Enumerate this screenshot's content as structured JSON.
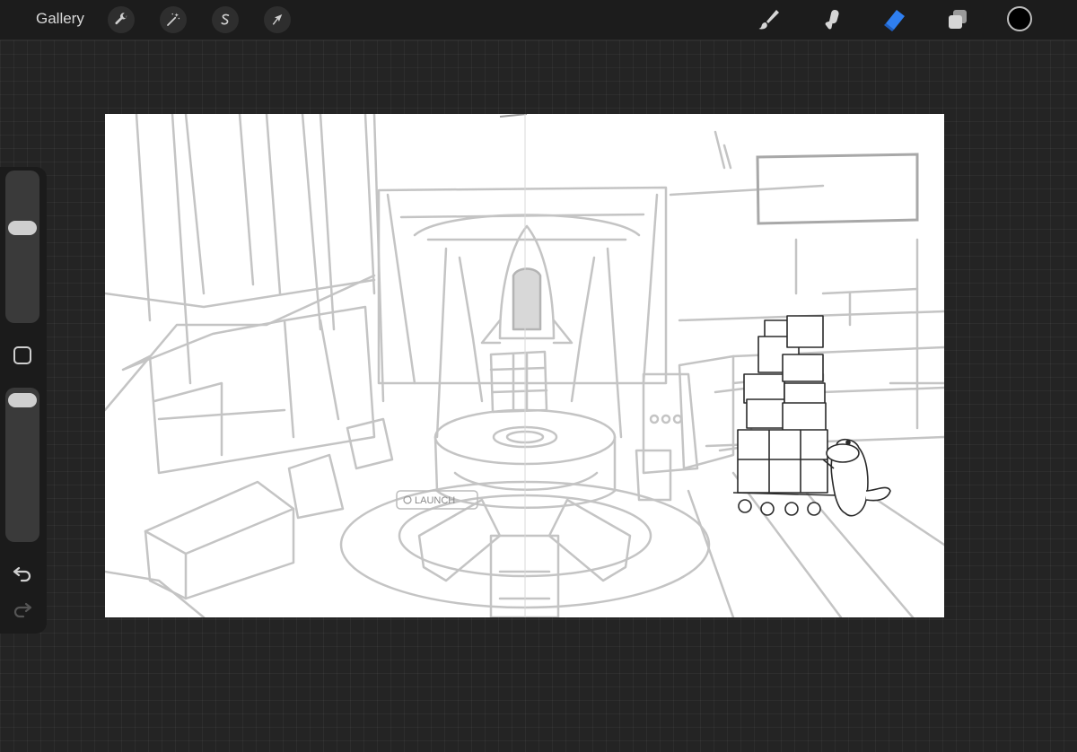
{
  "toolbar": {
    "gallery_label": "Gallery",
    "left_tools": [
      "wrench-icon",
      "magic-wand-icon",
      "selection-icon",
      "transform-arrow-icon"
    ],
    "right_tools": [
      "brush-icon",
      "smudge-icon",
      "eraser-icon",
      "layers-icon"
    ],
    "active_tool": "eraser",
    "accent_color": "#2f7ff0",
    "current_color": "#000000"
  },
  "sidebar": {
    "brush_size_level": 0.2,
    "opacity_level": 0.05,
    "icons": [
      "modify-square-icon",
      "undo-icon",
      "redo-icon"
    ]
  },
  "canvas": {
    "launch_label": "LAUNCH"
  }
}
